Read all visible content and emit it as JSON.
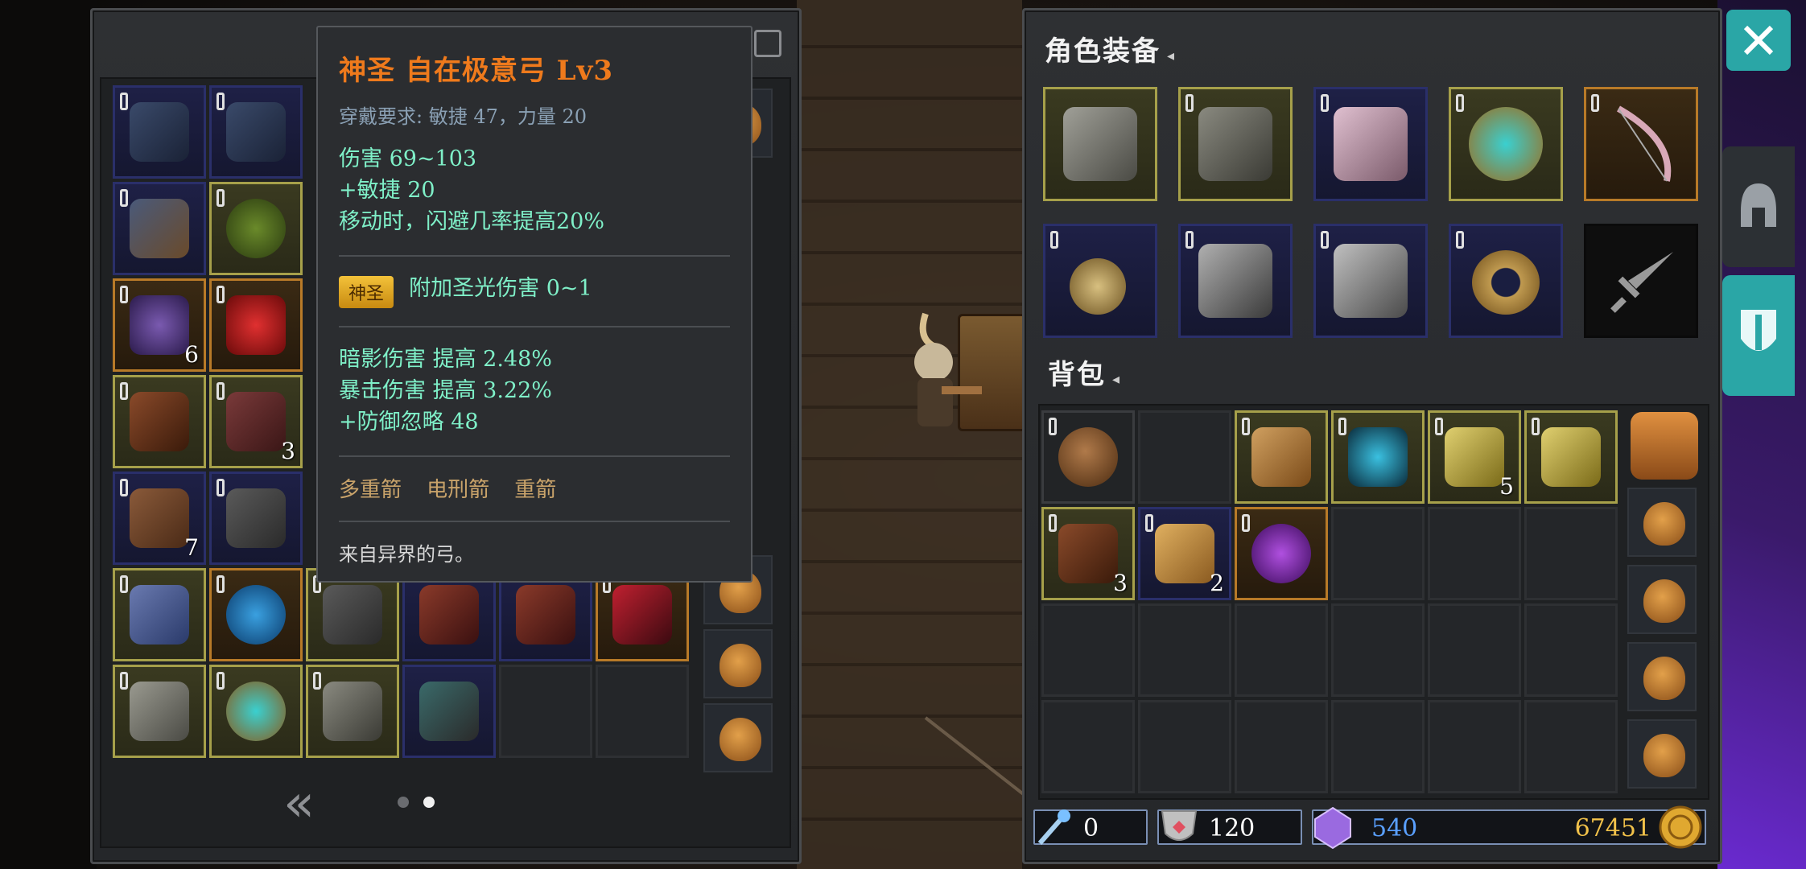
{
  "tooltip": {
    "title": "神圣 自在极意弓 Lv3",
    "requirement": "穿戴要求:  敏捷 47，力量 20",
    "stats": [
      "伤害  69~103",
      "+敏捷 20",
      "移动时，闪避几率提高20%"
    ],
    "badge": "神圣",
    "holy_bonus": "附加圣光伤害 0~1",
    "extra_stats": [
      "暗影伤害 提高 2.48%",
      "暴击伤害 提高 3.22%",
      "+防御忽略 48"
    ],
    "skills": [
      "多重箭",
      "电刑箭",
      "重箭"
    ],
    "description": "来自异界的弓。"
  },
  "left_inventory": {
    "counts": {
      "r3c1": "6",
      "r4c2": "3",
      "r5c1": "7"
    },
    "page_dots": 2,
    "active_page": 2
  },
  "equipment": {
    "title": "角色装备",
    "slots_row1": [
      "chest-armor",
      "shoulder-armor",
      "robe",
      "ring",
      "bow"
    ],
    "slots_row2": [
      "amulet",
      "gloves",
      "boots",
      "bracelet",
      "weapon-slot-empty"
    ]
  },
  "backpack": {
    "title": "背包",
    "counts": {
      "r1c5": "5",
      "r2c1": "3",
      "r2c2": "2"
    }
  },
  "currencies": {
    "wand": "0",
    "shield": "120",
    "crystal": "540",
    "gold": "67451"
  },
  "colors": {
    "legendary_orange": "#ef7a1c",
    "stat_green": "#7ff0c8",
    "crystal_blue": "#5aa0ff",
    "gold": "#f2c24a",
    "close_button": "#2aa6a6"
  }
}
